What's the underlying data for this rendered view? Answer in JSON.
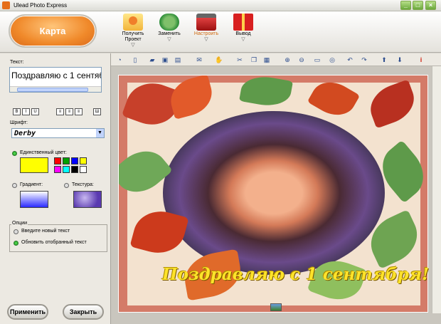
{
  "window": {
    "title": "Ulead Photo Express"
  },
  "toolbar": {
    "primary_label": "Карта",
    "tools": [
      {
        "label_line1": "Получить",
        "label_line2": "Проект"
      },
      {
        "label_line1": "Заменить",
        "label_line2": ""
      },
      {
        "label_line1": "Настроить",
        "label_line2": ""
      },
      {
        "label_line1": "Вывод",
        "label_line2": ""
      }
    ]
  },
  "panel": {
    "text_label": "Текст:",
    "text_value": "Поздравляю с 1 сентября!",
    "font_label": "Шрифт:",
    "font_value": "Derby",
    "solid_color_label": "Единственный цвет:",
    "solid_color": "#ffff00",
    "gradient_label": "Градиент:",
    "texture_label": "Текстура:",
    "options_label": "Опции",
    "option_new_text": "Введите новый текст",
    "option_update_text": "Обновить отобранный текст",
    "apply_button": "Применить",
    "close_button": "Закрыть",
    "palette": [
      "#ff0000",
      "#00a000",
      "#0000ff",
      "#ffff00",
      "#ff00ff",
      "#00ffff",
      "#000000",
      "#ffffff"
    ]
  },
  "canvas": {
    "headline": "Поздравляю с 1 сентября!"
  }
}
